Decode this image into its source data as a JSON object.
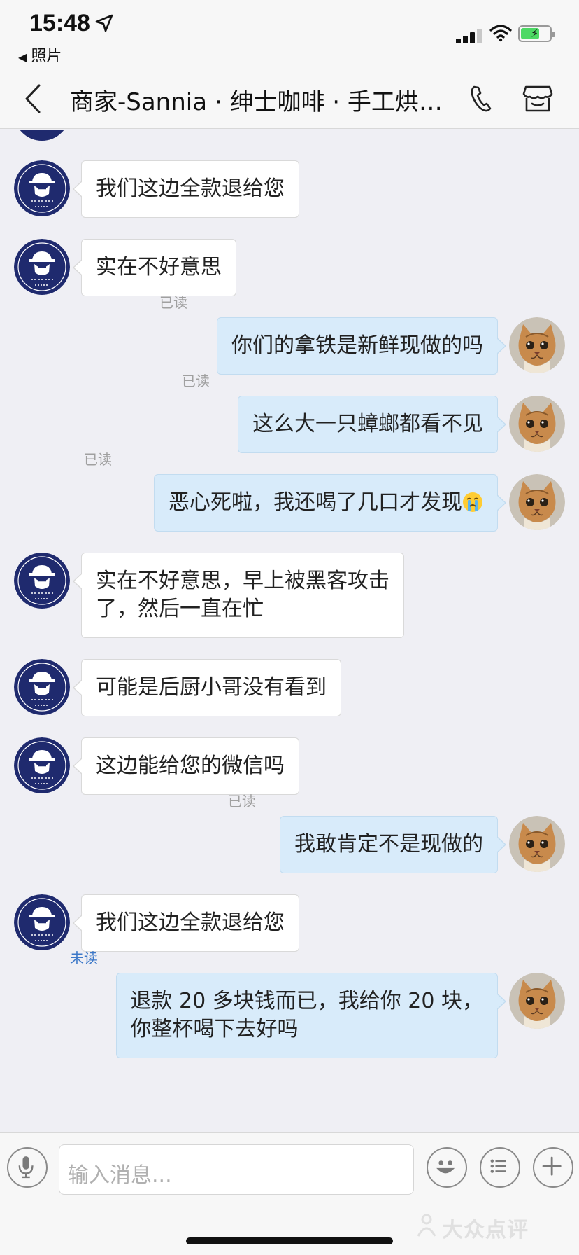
{
  "status_bar": {
    "time": "15:48",
    "back_app_label": "照片"
  },
  "nav": {
    "title": "商家-Sannia · 绅士咖啡 · 手工烘…"
  },
  "messages": [
    {
      "text": "我们这边全款退给您"
    },
    {
      "text": "实在不好意思"
    },
    {
      "text": "你们的拿铁是新鲜现做的吗",
      "read": "已读"
    },
    {
      "text": "这么大一只蟑螂都看不见",
      "read": "已读"
    },
    {
      "text": "恶心死啦，我还喝了几口才发现",
      "read": "已读",
      "emoji": "crying-face-emoji"
    },
    {
      "line1": "实在不好意思，早上被黑客攻击",
      "line2": "了，然后一直在忙"
    },
    {
      "text": "可能是后厨小哥没有看到"
    },
    {
      "text": "这边能给您的微信吗"
    },
    {
      "text": "我敢肯定不是现做的",
      "read": "已读"
    },
    {
      "text": "我们这边全款退给您"
    },
    {
      "line1": "退款 20 多块钱而已，我给你 20 块，",
      "line2": "你整杯喝下去好吗",
      "read": "未读"
    }
  ],
  "input": {
    "placeholder": "输入消息..."
  },
  "watermark": "大众点评",
  "colors": {
    "outgoing_bubble": "#d8ebfa",
    "incoming_bubble": "#ffffff",
    "background": "#efeff4",
    "unread": "#3c78c8",
    "merchant_avatar": "#1f2a6e"
  }
}
